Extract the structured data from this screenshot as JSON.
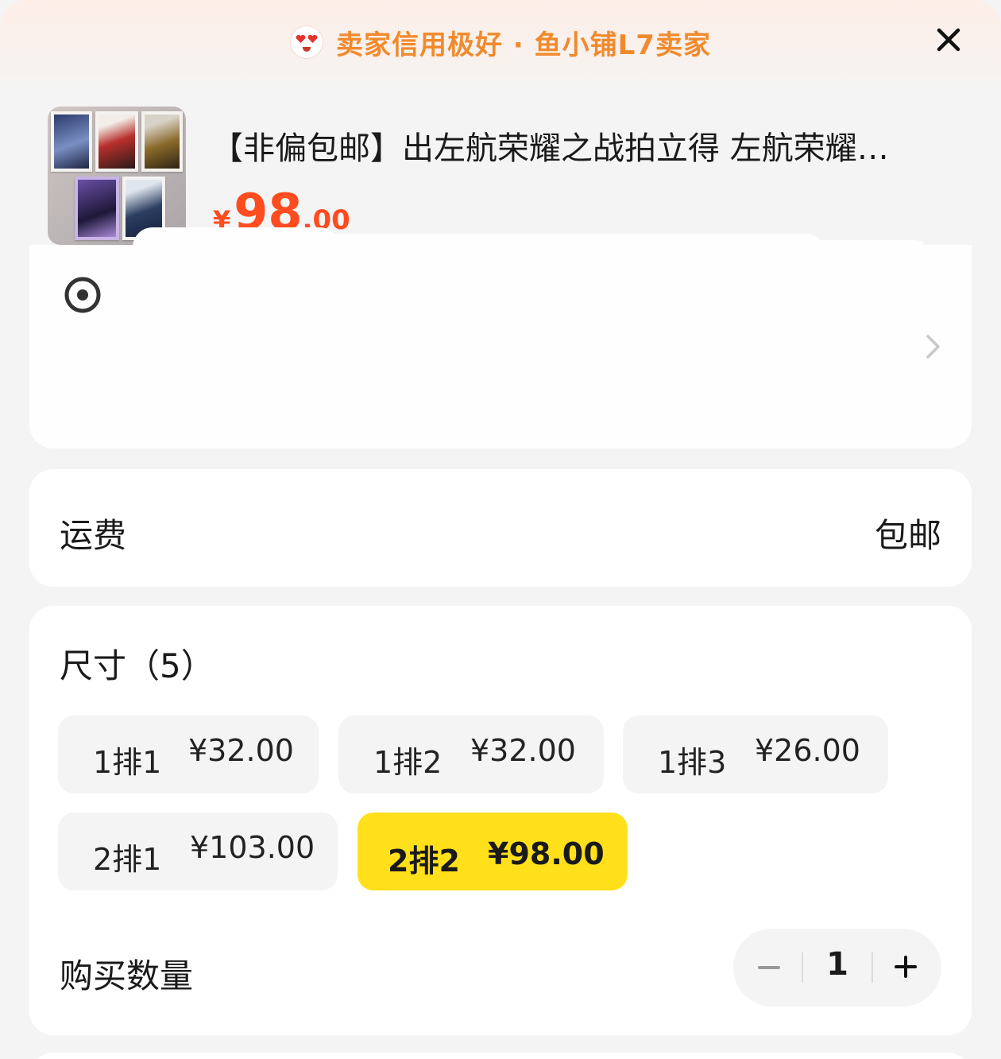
{
  "banner": {
    "text": "卖家信用极好 · 鱼小铺L7卖家"
  },
  "product": {
    "title": "【非偏包邮】出左航荣耀之战拍立得 左航荣耀…",
    "price": {
      "symbol": "¥",
      "integer": "98",
      "decimal": ".00"
    }
  },
  "shipping": {
    "label": "运费",
    "value": "包邮"
  },
  "options": {
    "title": "尺寸（5）",
    "items": [
      {
        "name": "1排1",
        "price": "¥32.00",
        "selected": false
      },
      {
        "name": "1排2",
        "price": "¥32.00",
        "selected": false
      },
      {
        "name": "1排3",
        "price": "¥26.00",
        "selected": false
      },
      {
        "name": "2排1",
        "price": "¥103.00",
        "selected": false
      },
      {
        "name": "2排2",
        "price": "¥98.00",
        "selected": true
      }
    ]
  },
  "quantity": {
    "label": "购买数量",
    "value": "1"
  },
  "colors": {
    "accent": "#ffe01b",
    "price": "#ff4c1f",
    "banner_text": "#f08a2c"
  }
}
